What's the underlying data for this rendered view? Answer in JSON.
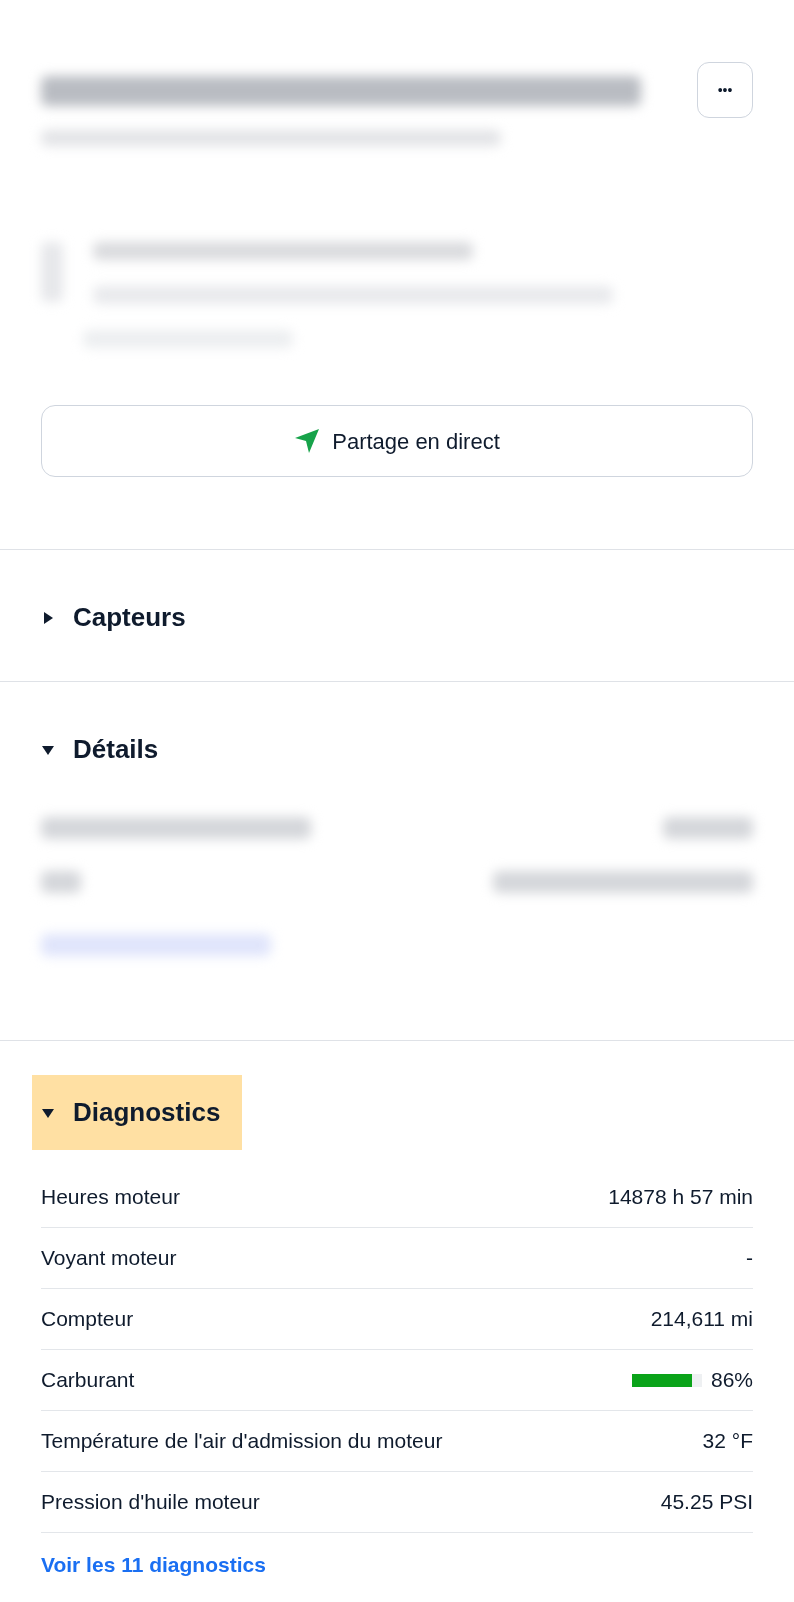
{
  "header": {
    "more_button": "•••"
  },
  "share_button": {
    "label": "Partage en direct"
  },
  "sections": [
    {
      "title": "Capteurs",
      "expanded": false,
      "highlighted": false
    },
    {
      "title": "Détails",
      "expanded": true,
      "highlighted": false,
      "kind": "blurred"
    },
    {
      "title": "Diagnostics",
      "expanded": true,
      "highlighted": true,
      "kind": "diagnostics",
      "rows": [
        {
          "kind": "text",
          "label": "Heures moteur",
          "value": "14878 h 57 min"
        },
        {
          "kind": "text",
          "label": "Voyant moteur",
          "value": "-"
        },
        {
          "kind": "text",
          "label": "Compteur",
          "value": "214,611 mi"
        },
        {
          "kind": "bar",
          "label": "Carburant",
          "level": 0.86,
          "value": "86%"
        },
        {
          "kind": "text",
          "label": "Température de l'air d'admission du moteur",
          "value": "32 °F"
        },
        {
          "kind": "text",
          "label": "Pression d'huile moteur",
          "value": "45.25 PSI"
        }
      ],
      "link": "Voir les 11 diagnostics"
    }
  ]
}
